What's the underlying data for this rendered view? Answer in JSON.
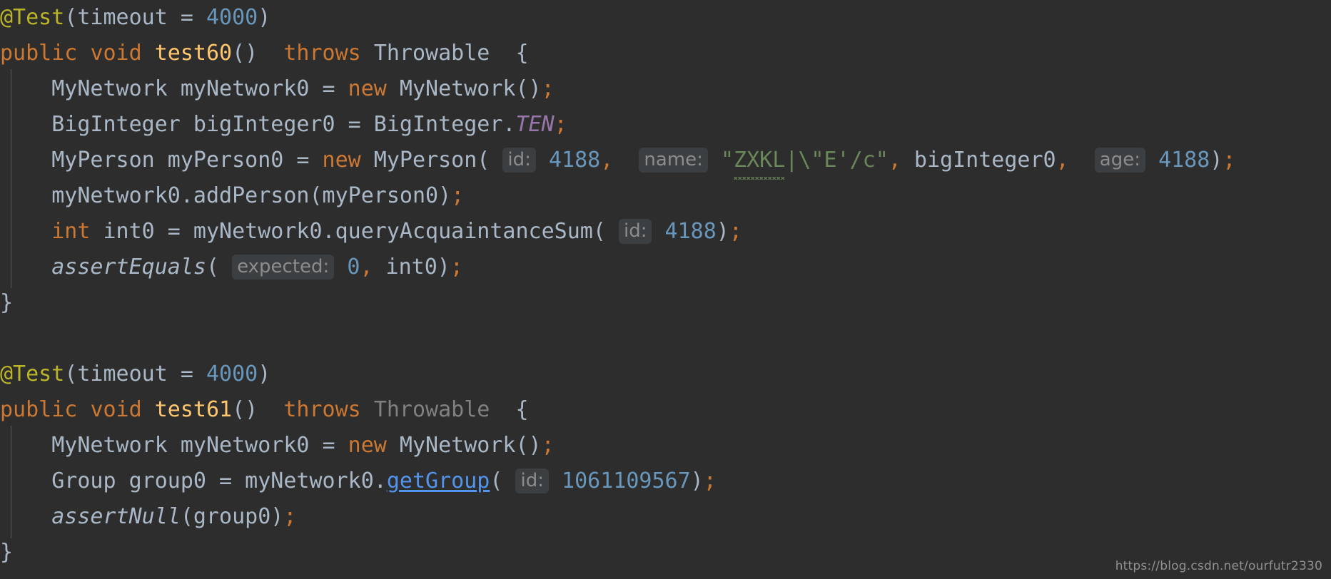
{
  "editor": {
    "theme": "darcula",
    "background_color": "#2d2d2d",
    "language": "Java",
    "colors": {
      "annotation": "#bbb529",
      "keyword": "#cc7832",
      "method": "#ffc66d",
      "number": "#6897bb",
      "string": "#6a8759",
      "default_text": "#a9b7c6",
      "constant": "#9876aa",
      "dimmed": "#808080",
      "link": "#5394ec",
      "hint_background": "#3c3f41",
      "hint_text": "#8c8c8c",
      "indent_guide": "#5a5a5a"
    }
  },
  "lines": [
    {
      "n": 1,
      "indent": 0,
      "tokens": [
        {
          "t": "@Test",
          "c": "annotation"
        },
        {
          "t": "(",
          "c": "punct"
        },
        {
          "t": "timeout",
          "c": "default"
        },
        {
          "t": " = ",
          "c": "default"
        },
        {
          "t": "4000",
          "c": "number"
        },
        {
          "t": ")",
          "c": "punct"
        }
      ]
    },
    {
      "n": 2,
      "indent": 0,
      "tokens": [
        {
          "t": "public",
          "c": "keyword"
        },
        {
          "t": " ",
          "c": "default"
        },
        {
          "t": "void",
          "c": "keyword"
        },
        {
          "t": " ",
          "c": "default"
        },
        {
          "t": "test60",
          "c": "method"
        },
        {
          "t": "()",
          "c": "punct"
        },
        {
          "t": "  ",
          "c": "default"
        },
        {
          "t": "throws",
          "c": "keyword"
        },
        {
          "t": " ",
          "c": "default"
        },
        {
          "t": "Throwable",
          "c": "default"
        },
        {
          "t": "  ",
          "c": "default"
        },
        {
          "t": "{",
          "c": "punct"
        }
      ]
    },
    {
      "n": 3,
      "indent": 1,
      "tokens": [
        {
          "t": "MyNetwork myNetwork0 = ",
          "c": "default"
        },
        {
          "t": "new",
          "c": "keyword"
        },
        {
          "t": " MyNetwork()",
          "c": "default"
        },
        {
          "t": ";",
          "c": "semi"
        }
      ]
    },
    {
      "n": 4,
      "indent": 1,
      "tokens": [
        {
          "t": "BigInteger bigInteger0 = BigInteger.",
          "c": "default"
        },
        {
          "t": "TEN",
          "c": "const"
        },
        {
          "t": ";",
          "c": "semi"
        }
      ]
    },
    {
      "n": 5,
      "indent": 1,
      "tokens": [
        {
          "t": "MyPerson myPerson0 = ",
          "c": "default"
        },
        {
          "t": "new",
          "c": "keyword"
        },
        {
          "t": " MyPerson(",
          "c": "default"
        },
        {
          "t": " ",
          "c": "default"
        },
        {
          "t": "id:",
          "c": "hint"
        },
        {
          "t": " ",
          "c": "default"
        },
        {
          "t": "4188",
          "c": "number"
        },
        {
          "t": ",",
          "c": "comma"
        },
        {
          "t": "  ",
          "c": "default"
        },
        {
          "t": "name:",
          "c": "hint"
        },
        {
          "t": " ",
          "c": "default"
        },
        {
          "t": "\"",
          "c": "string"
        },
        {
          "t": "ZXKL",
          "c": "string-squiggle"
        },
        {
          "t": "|\\\"E'/c\"",
          "c": "string"
        },
        {
          "t": ",",
          "c": "comma"
        },
        {
          "t": " bigInteger0",
          "c": "default"
        },
        {
          "t": ",",
          "c": "comma"
        },
        {
          "t": "  ",
          "c": "default"
        },
        {
          "t": "age:",
          "c": "hint"
        },
        {
          "t": " ",
          "c": "default"
        },
        {
          "t": "4188",
          "c": "number"
        },
        {
          "t": ")",
          "c": "punct"
        },
        {
          "t": ";",
          "c": "semi"
        }
      ]
    },
    {
      "n": 6,
      "indent": 1,
      "tokens": [
        {
          "t": "myNetwork0.addPerson(myPerson0)",
          "c": "default"
        },
        {
          "t": ";",
          "c": "semi"
        }
      ]
    },
    {
      "n": 7,
      "indent": 1,
      "tokens": [
        {
          "t": "int",
          "c": "keyword"
        },
        {
          "t": " int0 = myNetwork0.queryAcquaintanceSum(",
          "c": "default"
        },
        {
          "t": " ",
          "c": "default"
        },
        {
          "t": "id:",
          "c": "hint"
        },
        {
          "t": " ",
          "c": "default"
        },
        {
          "t": "4188",
          "c": "number"
        },
        {
          "t": ")",
          "c": "punct"
        },
        {
          "t": ";",
          "c": "semi"
        }
      ]
    },
    {
      "n": 8,
      "indent": 1,
      "tokens": [
        {
          "t": "assertEquals",
          "c": "static"
        },
        {
          "t": "(",
          "c": "punct"
        },
        {
          "t": " ",
          "c": "default"
        },
        {
          "t": "expected:",
          "c": "hint"
        },
        {
          "t": " ",
          "c": "default"
        },
        {
          "t": "0",
          "c": "number"
        },
        {
          "t": ",",
          "c": "comma"
        },
        {
          "t": " int0)",
          "c": "default"
        },
        {
          "t": ";",
          "c": "semi"
        }
      ]
    },
    {
      "n": 9,
      "indent": 0,
      "tokens": [
        {
          "t": "}",
          "c": "punct"
        }
      ]
    },
    {
      "n": 10,
      "indent": 0,
      "tokens": []
    },
    {
      "n": 11,
      "indent": 0,
      "tokens": [
        {
          "t": "@Test",
          "c": "annotation"
        },
        {
          "t": "(",
          "c": "punct"
        },
        {
          "t": "timeout",
          "c": "default"
        },
        {
          "t": " = ",
          "c": "default"
        },
        {
          "t": "4000",
          "c": "number"
        },
        {
          "t": ")",
          "c": "punct"
        }
      ]
    },
    {
      "n": 12,
      "indent": 0,
      "tokens": [
        {
          "t": "public",
          "c": "keyword"
        },
        {
          "t": " ",
          "c": "default"
        },
        {
          "t": "void",
          "c": "keyword"
        },
        {
          "t": " ",
          "c": "default"
        },
        {
          "t": "test61",
          "c": "method"
        },
        {
          "t": "()",
          "c": "punct"
        },
        {
          "t": "  ",
          "c": "default"
        },
        {
          "t": "throws",
          "c": "keyword"
        },
        {
          "t": " ",
          "c": "default"
        },
        {
          "t": "Throwable",
          "c": "dim"
        },
        {
          "t": "  ",
          "c": "default"
        },
        {
          "t": "{",
          "c": "punct"
        }
      ]
    },
    {
      "n": 13,
      "indent": 1,
      "tokens": [
        {
          "t": "MyNetwork myNetwork0 = ",
          "c": "default"
        },
        {
          "t": "new",
          "c": "keyword"
        },
        {
          "t": " MyNetwork()",
          "c": "default"
        },
        {
          "t": ";",
          "c": "semi"
        }
      ]
    },
    {
      "n": 14,
      "indent": 1,
      "tokens": [
        {
          "t": "Group group0 = myNetwork0.",
          "c": "default"
        },
        {
          "t": "getGroup",
          "c": "link"
        },
        {
          "t": "(",
          "c": "punct"
        },
        {
          "t": " ",
          "c": "default"
        },
        {
          "t": "id:",
          "c": "hint"
        },
        {
          "t": " ",
          "c": "default"
        },
        {
          "t": "1061109567",
          "c": "number"
        },
        {
          "t": ")",
          "c": "punct"
        },
        {
          "t": ";",
          "c": "semi"
        }
      ]
    },
    {
      "n": 15,
      "indent": 1,
      "tokens": [
        {
          "t": "assertNull",
          "c": "static"
        },
        {
          "t": "(group0)",
          "c": "default"
        },
        {
          "t": ";",
          "c": "semi"
        }
      ]
    },
    {
      "n": 16,
      "indent": 0,
      "tokens": [
        {
          "t": "}",
          "c": "punct"
        }
      ]
    }
  ],
  "watermark": {
    "text": "https://blog.csdn.net/ourfutr2330"
  }
}
